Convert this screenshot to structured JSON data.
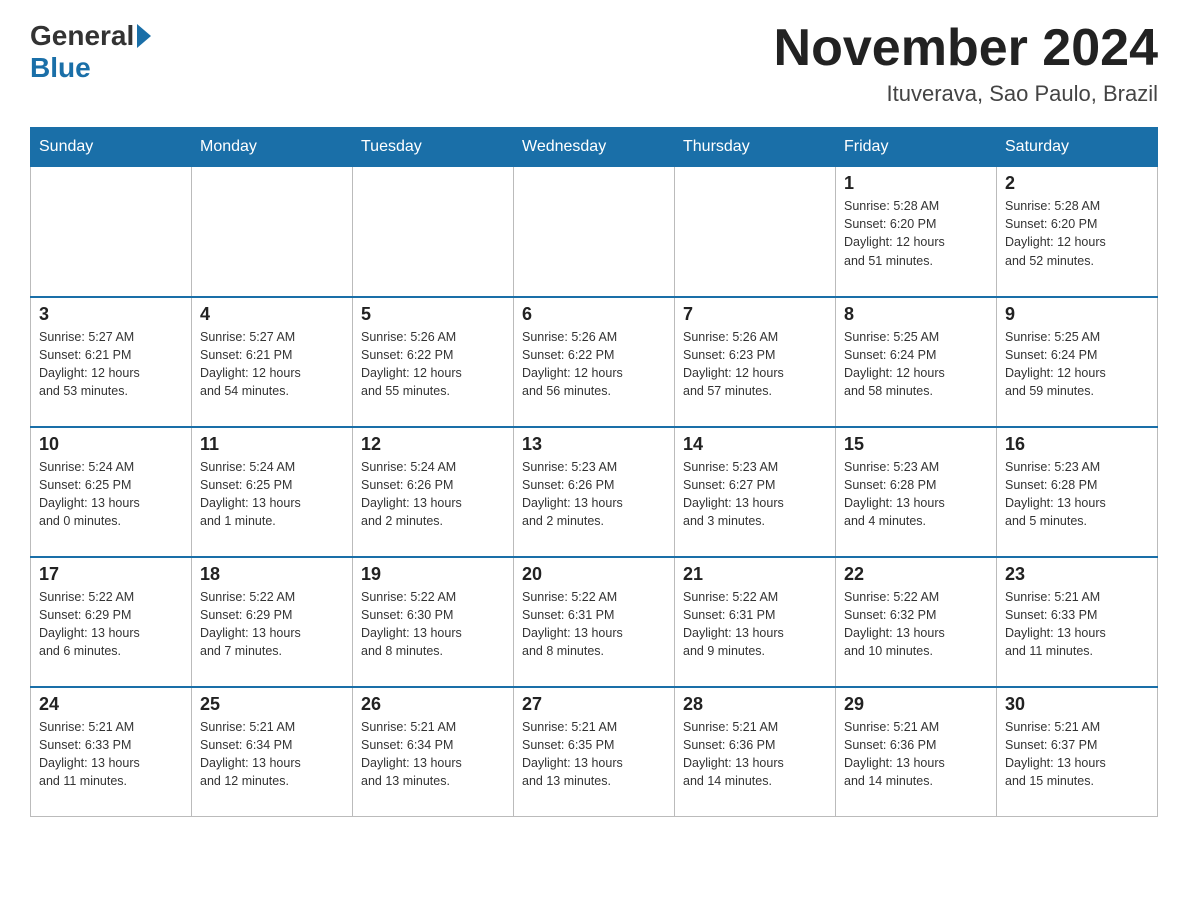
{
  "header": {
    "logo_general": "General",
    "logo_blue": "Blue",
    "month_title": "November 2024",
    "subtitle": "Ituverava, Sao Paulo, Brazil"
  },
  "days_of_week": [
    "Sunday",
    "Monday",
    "Tuesday",
    "Wednesday",
    "Thursday",
    "Friday",
    "Saturday"
  ],
  "weeks": [
    [
      {
        "day": "",
        "info": ""
      },
      {
        "day": "",
        "info": ""
      },
      {
        "day": "",
        "info": ""
      },
      {
        "day": "",
        "info": ""
      },
      {
        "day": "",
        "info": ""
      },
      {
        "day": "1",
        "info": "Sunrise: 5:28 AM\nSunset: 6:20 PM\nDaylight: 12 hours\nand 51 minutes."
      },
      {
        "day": "2",
        "info": "Sunrise: 5:28 AM\nSunset: 6:20 PM\nDaylight: 12 hours\nand 52 minutes."
      }
    ],
    [
      {
        "day": "3",
        "info": "Sunrise: 5:27 AM\nSunset: 6:21 PM\nDaylight: 12 hours\nand 53 minutes."
      },
      {
        "day": "4",
        "info": "Sunrise: 5:27 AM\nSunset: 6:21 PM\nDaylight: 12 hours\nand 54 minutes."
      },
      {
        "day": "5",
        "info": "Sunrise: 5:26 AM\nSunset: 6:22 PM\nDaylight: 12 hours\nand 55 minutes."
      },
      {
        "day": "6",
        "info": "Sunrise: 5:26 AM\nSunset: 6:22 PM\nDaylight: 12 hours\nand 56 minutes."
      },
      {
        "day": "7",
        "info": "Sunrise: 5:26 AM\nSunset: 6:23 PM\nDaylight: 12 hours\nand 57 minutes."
      },
      {
        "day": "8",
        "info": "Sunrise: 5:25 AM\nSunset: 6:24 PM\nDaylight: 12 hours\nand 58 minutes."
      },
      {
        "day": "9",
        "info": "Sunrise: 5:25 AM\nSunset: 6:24 PM\nDaylight: 12 hours\nand 59 minutes."
      }
    ],
    [
      {
        "day": "10",
        "info": "Sunrise: 5:24 AM\nSunset: 6:25 PM\nDaylight: 13 hours\nand 0 minutes."
      },
      {
        "day": "11",
        "info": "Sunrise: 5:24 AM\nSunset: 6:25 PM\nDaylight: 13 hours\nand 1 minute."
      },
      {
        "day": "12",
        "info": "Sunrise: 5:24 AM\nSunset: 6:26 PM\nDaylight: 13 hours\nand 2 minutes."
      },
      {
        "day": "13",
        "info": "Sunrise: 5:23 AM\nSunset: 6:26 PM\nDaylight: 13 hours\nand 2 minutes."
      },
      {
        "day": "14",
        "info": "Sunrise: 5:23 AM\nSunset: 6:27 PM\nDaylight: 13 hours\nand 3 minutes."
      },
      {
        "day": "15",
        "info": "Sunrise: 5:23 AM\nSunset: 6:28 PM\nDaylight: 13 hours\nand 4 minutes."
      },
      {
        "day": "16",
        "info": "Sunrise: 5:23 AM\nSunset: 6:28 PM\nDaylight: 13 hours\nand 5 minutes."
      }
    ],
    [
      {
        "day": "17",
        "info": "Sunrise: 5:22 AM\nSunset: 6:29 PM\nDaylight: 13 hours\nand 6 minutes."
      },
      {
        "day": "18",
        "info": "Sunrise: 5:22 AM\nSunset: 6:29 PM\nDaylight: 13 hours\nand 7 minutes."
      },
      {
        "day": "19",
        "info": "Sunrise: 5:22 AM\nSunset: 6:30 PM\nDaylight: 13 hours\nand 8 minutes."
      },
      {
        "day": "20",
        "info": "Sunrise: 5:22 AM\nSunset: 6:31 PM\nDaylight: 13 hours\nand 8 minutes."
      },
      {
        "day": "21",
        "info": "Sunrise: 5:22 AM\nSunset: 6:31 PM\nDaylight: 13 hours\nand 9 minutes."
      },
      {
        "day": "22",
        "info": "Sunrise: 5:22 AM\nSunset: 6:32 PM\nDaylight: 13 hours\nand 10 minutes."
      },
      {
        "day": "23",
        "info": "Sunrise: 5:21 AM\nSunset: 6:33 PM\nDaylight: 13 hours\nand 11 minutes."
      }
    ],
    [
      {
        "day": "24",
        "info": "Sunrise: 5:21 AM\nSunset: 6:33 PM\nDaylight: 13 hours\nand 11 minutes."
      },
      {
        "day": "25",
        "info": "Sunrise: 5:21 AM\nSunset: 6:34 PM\nDaylight: 13 hours\nand 12 minutes."
      },
      {
        "day": "26",
        "info": "Sunrise: 5:21 AM\nSunset: 6:34 PM\nDaylight: 13 hours\nand 13 minutes."
      },
      {
        "day": "27",
        "info": "Sunrise: 5:21 AM\nSunset: 6:35 PM\nDaylight: 13 hours\nand 13 minutes."
      },
      {
        "day": "28",
        "info": "Sunrise: 5:21 AM\nSunset: 6:36 PM\nDaylight: 13 hours\nand 14 minutes."
      },
      {
        "day": "29",
        "info": "Sunrise: 5:21 AM\nSunset: 6:36 PM\nDaylight: 13 hours\nand 14 minutes."
      },
      {
        "day": "30",
        "info": "Sunrise: 5:21 AM\nSunset: 6:37 PM\nDaylight: 13 hours\nand 15 minutes."
      }
    ]
  ]
}
